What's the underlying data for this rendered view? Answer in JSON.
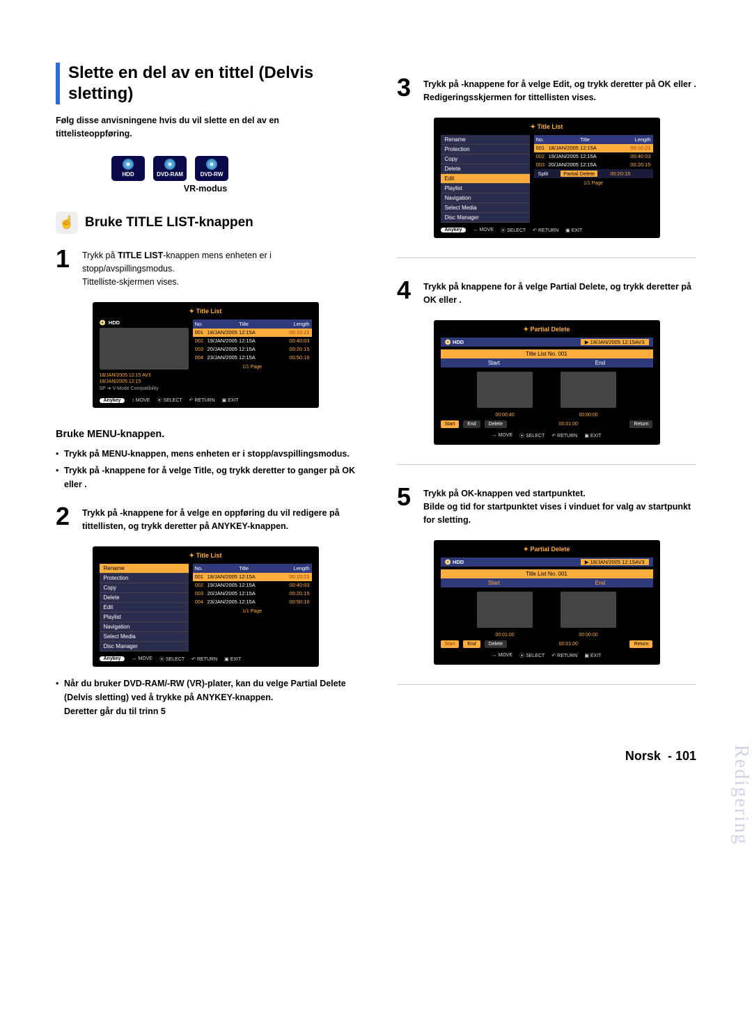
{
  "section_title": "Slette en del av en tittel (Delvis sletting)",
  "intro": "Følg disse anvisningene hvis du vil slette en del av en tittelisteoppføring.",
  "media": {
    "hdd": "HDD",
    "ram": "DVD-RAM",
    "rw": "DVD-RW",
    "sub": "VR-modus"
  },
  "subhead": "Bruke TITLE LIST-knappen",
  "step1": {
    "a": "Trykk på ",
    "b": "TITLE LIST",
    "c": "-knappen mens enheten er i stopp/avspillingsmodus.",
    "d": "Tittelliste-skjermen vises."
  },
  "menu_head": "Bruke MENU-knappen.",
  "menu_b1": {
    "a": "Trykk på  ",
    "b": "MENU",
    "c": "-knappen, mens enheten er i stopp/avspillingsmodus."
  },
  "menu_b2": {
    "a": "Trykk på       -knappene for å velge   ",
    "b": "Title",
    "c": ", og trykk deretter to ganger på   ",
    "d": "OK",
    "e": " eller      ."
  },
  "step2": {
    "a": "Trykk på        -knappene for å velge en oppføring du vil redigere på tittellisten, og trykk deretter på ",
    "b": "ANYKEY",
    "c": "-knappen."
  },
  "note": {
    "a": "Når du bruker DVD-RAM/-RW (VR)-plater, kan du velge Partial Delete (Delvis sletting) ved å trykke på  ",
    "b": "ANYKEY",
    "c": "-knappen.",
    "d": "Deretter går du til trinn 5"
  },
  "step3": {
    "a": "Trykk på        -knappene for å velge   ",
    "b": "Edit",
    "c": ", og trykk deretter på  ",
    "d": "OK",
    "e": " eller      .",
    "f": "Redigeringsskjermen for tittellisten vises."
  },
  "step4": {
    "a": "Trykk på        knappene for å velge   ",
    "b": "Partial Delete",
    "c": ", og trykk deretter på  ",
    "d": "OK",
    "e": " eller      ."
  },
  "step5": {
    "a": "Trykk på  ",
    "b": "OK",
    "c": "-knappen ved startpunktet.",
    "d": "Bilde og tid for startpunktet vises i vinduet for valg av startpunkt for sletting."
  },
  "osd_common": {
    "title_list": "Title List",
    "partial_delete": "Partial Delete",
    "hdd": "HDD",
    "cols": {
      "no": "No.",
      "title": "Title",
      "len": "Length"
    },
    "rows": [
      {
        "n": "001",
        "t": "18/JAN/2005 12:15A",
        "l": "00:10:21"
      },
      {
        "n": "002",
        "t": "19/JAN/2005 12:15A",
        "l": "00:40:03"
      },
      {
        "n": "003",
        "t": "20/JAN/2005 12:15A",
        "l": "00:20:15"
      },
      {
        "n": "004",
        "t": "23/JAN/2005 12:15A",
        "l": "00:50:16"
      }
    ],
    "thumb1": "18/JAN/2005 12:15 AV3",
    "thumb2": "18/JAN/2005 12:15",
    "thumb3": "SP ➔ V-Mode Compatibility",
    "page": "1/1 Page",
    "anykey": "Anykey",
    "move": "MOVE",
    "select": "SELECT",
    "return": "RETURN",
    "exit": "EXIT",
    "menu": [
      "Rename",
      "Protection",
      "Copy",
      "Delete",
      "Edit",
      "Playlist",
      "Navigation",
      "Select Media",
      "Disc Manager"
    ],
    "split": "Split",
    "pd": "Partial Delete",
    "pd_len": "00:20:15",
    "pd_title": "18/JAN/2005 12:15AV3",
    "pd_list": "Title List No. 001",
    "start": "Start",
    "end": "End",
    "tc1": "00:00:40",
    "tc2": "00:00:00",
    "tc3": "00:01:00",
    "tc4": "00:00:00",
    "clock": "00:01:00",
    "delete": "Delete",
    "ret": "Return"
  },
  "side": "Redigering",
  "footer": {
    "lang": "Norsk",
    "dash": "-",
    "num": "101"
  }
}
